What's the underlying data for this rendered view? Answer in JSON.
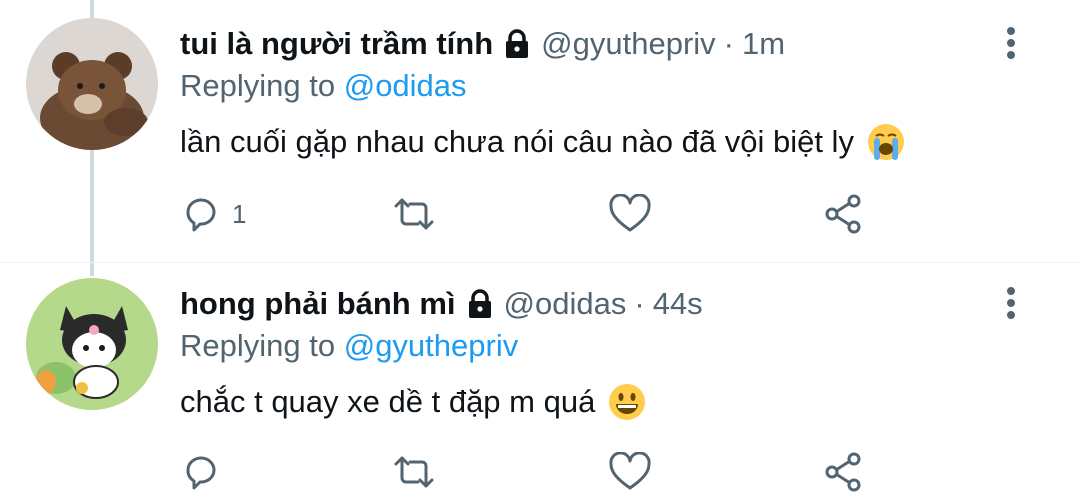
{
  "tweets": [
    {
      "display_name": "tui là người trầm tính",
      "handle": "@gyuthepriv",
      "separator": "·",
      "time": "1m",
      "replying_prefix": "Replying to",
      "replying_to": "@odidas",
      "text": "lần cuối gặp nhau chưa nói câu nào đã vội biệt ly",
      "emoji": "loudly-crying-face",
      "reply_count": "1",
      "avatar": "teddy-bear-avatar"
    },
    {
      "display_name": "hong phải bánh mì",
      "handle": "@odidas",
      "separator": "·",
      "time": "44s",
      "replying_prefix": "Replying to",
      "replying_to": "@gyuthepriv",
      "text": "chắc t quay xe dề t đặp m quá",
      "emoji": "grinning-face",
      "reply_count": "",
      "avatar": "kuromi-avatar"
    }
  ],
  "colors": {
    "accent": "#1d9bf0",
    "secondary_text": "#536471",
    "thread_line": "#cfd9de"
  }
}
